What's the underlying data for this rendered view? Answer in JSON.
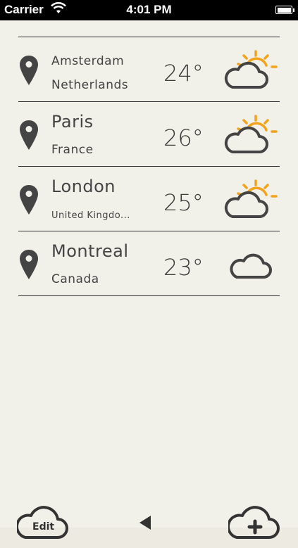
{
  "status_bar": {
    "carrier": "Carrier",
    "time": "4:01 PM"
  },
  "locations": [
    {
      "city": "Amsterdam",
      "country": "Netherlands",
      "temp": "24°",
      "icon": "partly-sunny-icon"
    },
    {
      "city": "Paris",
      "country": "France",
      "temp": "26°",
      "icon": "partly-sunny-icon"
    },
    {
      "city": "London",
      "country": "United Kingdo...",
      "temp": "25°",
      "icon": "partly-sunny-icon"
    },
    {
      "city": "Montreal",
      "country": "Canada",
      "temp": "23°",
      "icon": "cloud-icon"
    }
  ],
  "toolbar": {
    "edit_label": "Edit"
  },
  "colors": {
    "sun": "#f2a31b",
    "stroke": "#444444",
    "background": "#f1f0e9"
  }
}
